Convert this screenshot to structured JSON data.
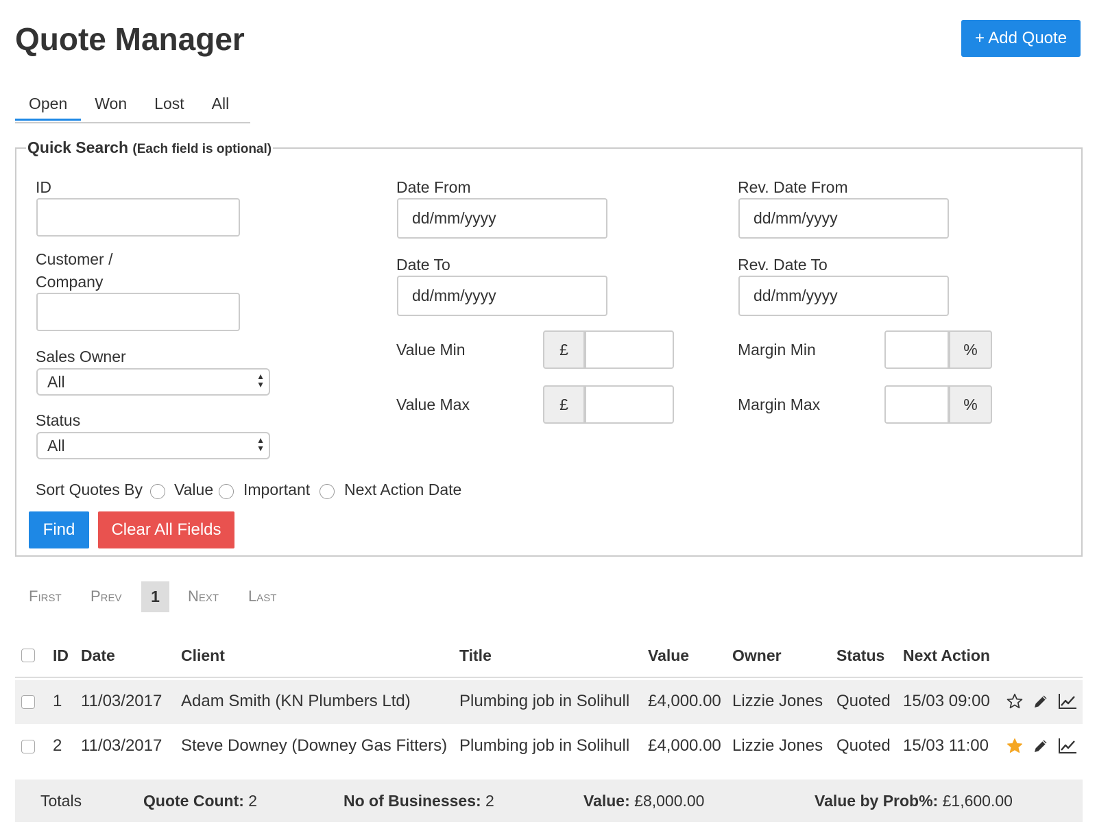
{
  "header": {
    "title": "Quote Manager",
    "add_button": "+ Add Quote"
  },
  "tabs": [
    {
      "label": "Open",
      "active": true
    },
    {
      "label": "Won"
    },
    {
      "label": "Lost"
    },
    {
      "label": "All"
    }
  ],
  "search": {
    "legend": "Quick Search",
    "legend_note": "(Each field is optional)",
    "id_label": "ID",
    "customer_label_1": "Customer /",
    "customer_label_2": "Company",
    "sales_owner_label": "Sales Owner",
    "sales_owner_value": "All",
    "status_label": "Status",
    "status_value": "All",
    "date_from_label": "Date From",
    "date_to_label": "Date To",
    "rev_date_from_label": "Rev. Date From",
    "rev_date_to_label": "Rev. Date To",
    "date_placeholder": "dd/mm/yyyy",
    "value_min_label": "Value Min",
    "value_max_label": "Value Max",
    "currency_symbol": "£",
    "margin_min_label": "Margin Min",
    "margin_max_label": "Margin Max",
    "percent_symbol": "%",
    "sort_label": "Sort Quotes By",
    "sort_options": [
      "Value",
      "Important",
      "Next Action Date"
    ],
    "find_button": "Find",
    "clear_button": "Clear All Fields"
  },
  "pagination": {
    "first": "First",
    "prev": "Prev",
    "current": "1",
    "next": "Next",
    "last": "Last"
  },
  "table": {
    "headers": {
      "id": "ID",
      "date": "Date",
      "client": "Client",
      "title": "Title",
      "value": "Value",
      "owner": "Owner",
      "status": "Status",
      "next_action": "Next Action"
    },
    "rows": [
      {
        "id": "1",
        "date": "11/03/2017",
        "client": "Adam Smith (KN Plumbers Ltd)",
        "title": "Plumbing job in Solihull",
        "value": "£4,000.00",
        "owner": "Lizzie Jones",
        "status": "Quoted",
        "next_action": "15/03 09:00",
        "important": false
      },
      {
        "id": "2",
        "date": "11/03/2017",
        "client": "Steve Downey (Downey Gas Fitters)",
        "title": "Plumbing job in Solihull",
        "value": "£4,000.00",
        "owner": "Lizzie Jones",
        "status": "Quoted",
        "next_action": "15/03 11:00",
        "important": true
      }
    ]
  },
  "totals": {
    "label": "Totals",
    "quote_count_label": "Quote Count:",
    "quote_count": "2",
    "businesses_label": "No of Businesses:",
    "businesses": "2",
    "value_label": "Value:",
    "value": "£8,000.00",
    "value_prob_label": "Value by Prob%:",
    "value_prob": "£1,600.00"
  },
  "colors": {
    "primary": "#1e88e5",
    "danger": "#e9524f",
    "star_active": "#f5a623"
  },
  "icons": {
    "star_outline": "star-outline-icon",
    "star_filled": "star-filled-icon",
    "edit": "pencil-icon",
    "chart": "trend-chart-icon"
  }
}
